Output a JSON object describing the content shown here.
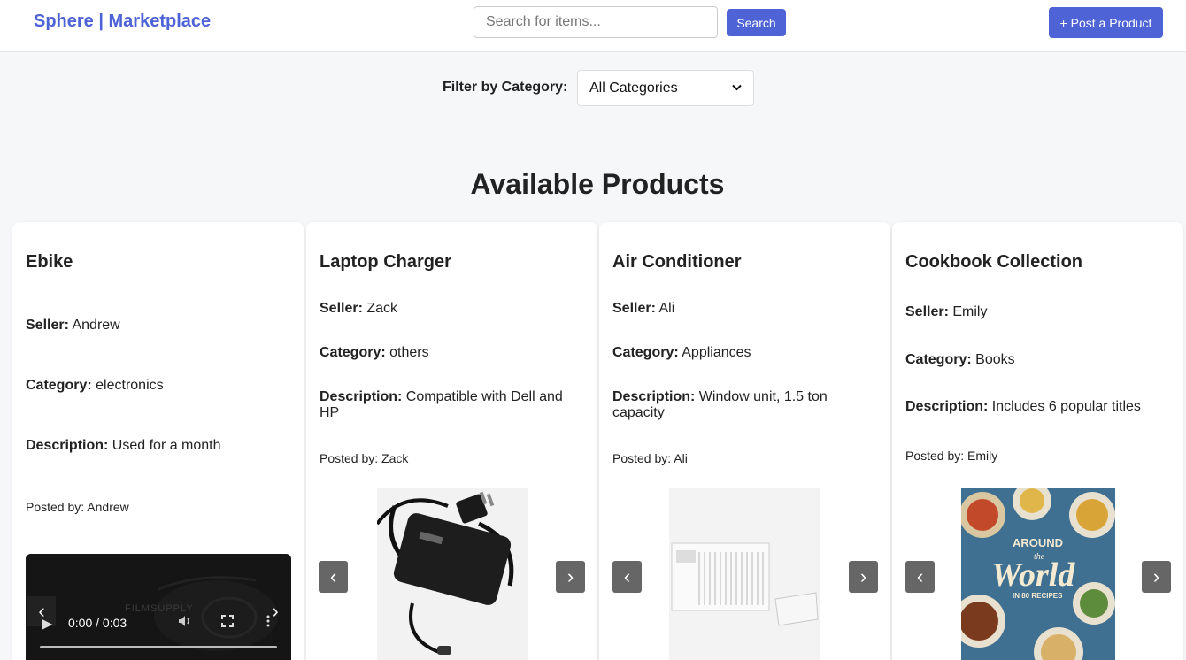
{
  "header": {
    "brand": "Sphere | Marketplace",
    "search_placeholder": "Search for items...",
    "search_value": "",
    "search_label": "Search",
    "post_label": "+ Post a Product"
  },
  "filter": {
    "label": "Filter by Category:",
    "selected": "All Categories"
  },
  "section_title": "Available Products",
  "labels": {
    "seller": "Seller:",
    "category": "Category:",
    "description": "Description:",
    "posted_prefix": "Posted by:"
  },
  "products": [
    {
      "name": "Ebike",
      "seller": "Andrew",
      "category": "electronics",
      "description": "Used for a month",
      "posted_by": "Andrew",
      "media": "video",
      "video_time": "0:00 / 0:03",
      "video_watermark": "FILMSUPPLY"
    },
    {
      "name": "Laptop Charger",
      "seller": "Zack",
      "category": "others",
      "description": "Compatible with Dell and HP",
      "posted_by": "Zack",
      "media": "image",
      "image_icon": "laptop-charger-image"
    },
    {
      "name": "Air Conditioner",
      "seller": "Ali",
      "category": "Appliances",
      "description": "Window unit, 1.5 ton capacity",
      "posted_by": "Ali",
      "media": "image",
      "image_icon": "air-conditioner-image"
    },
    {
      "name": "Cookbook Collection",
      "seller": "Emily",
      "category": "Books",
      "description": "Includes 6 popular titles",
      "posted_by": "Emily",
      "media": "image",
      "image_icon": "cookbook-image",
      "image_text": [
        "AROUND",
        "the",
        "World",
        "IN 80 RECIPES"
      ]
    }
  ],
  "icons": {
    "prev": "chevron-left-icon",
    "next": "chevron-right-icon"
  },
  "colors": {
    "accent": "#4e63d6",
    "background": "#f6f7f9",
    "arrow_bg": "#666666"
  }
}
